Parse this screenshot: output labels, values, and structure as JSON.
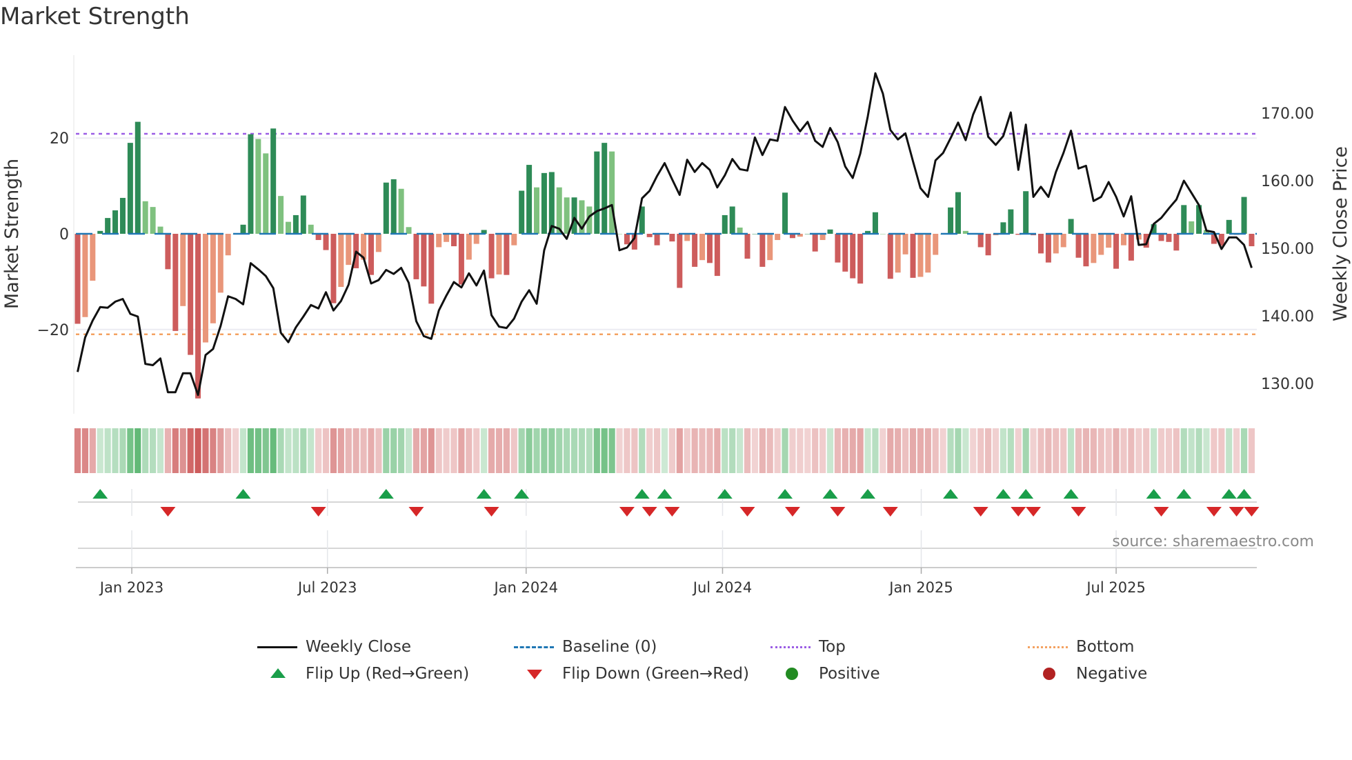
{
  "title": "Market Strength",
  "source": "source: sharemaestro.com",
  "legend": {
    "weekly_close": "Weekly Close",
    "baseline": "Baseline (0)",
    "top": "Top",
    "bottom": "Bottom",
    "flip_up": "Flip Up (Red→Green)",
    "flip_down": "Flip Down (Green→Red)",
    "positive": "Positive",
    "negative": "Negative"
  },
  "colors": {
    "close": "#111111",
    "baseline": "#1f77b4",
    "top": "#9b5de5",
    "bottom": "#f4a261",
    "pos_strong": "#2e8b57",
    "pos_weak": "#7fc17f",
    "neg_strong": "#cd5c5c",
    "neg_weak": "#e9967a",
    "flip_up": "#1a9e4a",
    "flip_down": "#d62728",
    "positive_dot": "#228b22",
    "negative_dot": "#b22222"
  },
  "chart_data": {
    "type": "bar",
    "title": "Market Strength",
    "ylabel": "Market Strength",
    "y2label": "Weekly Close Price",
    "ylim": [
      -37,
      37
    ],
    "y2lim": [
      126,
      178
    ],
    "yticks": [
      {
        "value": 20,
        "label": "20"
      },
      {
        "value": 0,
        "label": "0"
      },
      {
        "value": -20,
        "label": "−20"
      }
    ],
    "y2ticks": [
      {
        "value": 170,
        "label": "170.00"
      },
      {
        "value": 160,
        "label": "160.00"
      },
      {
        "value": 150,
        "label": "150.00"
      },
      {
        "value": 140,
        "label": "140.00"
      },
      {
        "value": 130,
        "label": "130.00"
      }
    ],
    "xticks": [
      {
        "week": 7.2,
        "label": "Jan 2023"
      },
      {
        "week": 33.2,
        "label": "Jul 2023"
      },
      {
        "week": 59.6,
        "label": "Jan 2024"
      },
      {
        "week": 85.7,
        "label": "Jul 2024"
      },
      {
        "week": 112.1,
        "label": "Jan 2025"
      },
      {
        "week": 138,
        "label": "Jul 2025"
      }
    ],
    "top_level": 20.9,
    "bottom_level": -21.0,
    "baseline": 0,
    "strength": [
      -18.8,
      -17.4,
      -9.8,
      0.6,
      3.3,
      4.9,
      7.5,
      19,
      23.4,
      6.8,
      5.6,
      1.5,
      -7.4,
      -20.3,
      -15.1,
      -25.3,
      -34.4,
      -22.7,
      -18.7,
      -12.3,
      -4.5,
      0,
      1.9,
      20.8,
      19.8,
      16.8,
      22,
      7.9,
      2.5,
      3.9,
      8,
      1.9,
      -1.3,
      -3.4,
      -14.5,
      -11.1,
      -6.5,
      -7.2,
      -5.4,
      -8.6,
      -3.8,
      10.7,
      11.4,
      9.4,
      1.4,
      -9.5,
      -11,
      -14.6,
      -2.8,
      -1.7,
      -2.6,
      -10.6,
      -5.4,
      -2.1,
      0.8,
      -9.3,
      -8.5,
      -8.6,
      -2.4,
      9,
      14.4,
      9.7,
      12.7,
      12.9,
      9.7,
      7.6,
      7.6,
      7,
      5.7,
      17.2,
      19,
      17.2,
      0,
      -2.2,
      -3.3,
      5.7,
      -0.7,
      -2.4,
      0.1,
      -1.6,
      -11.3,
      -1.5,
      -6.9,
      -5.5,
      -6.1,
      -8.8,
      3.9,
      5.7,
      1.3,
      -5.2,
      0,
      -6.9,
      -5.5,
      -1.3,
      8.6,
      -0.9,
      -0.6,
      0,
      -3.7,
      -1.3,
      0.9,
      -6,
      -7.9,
      -9.3,
      -10.4,
      0.6,
      4.5,
      0,
      -9.4,
      -8.1,
      -4.3,
      -9.2,
      -9,
      -8.1,
      -4.4,
      0,
      5.5,
      8.7,
      0.6,
      0,
      -2.8,
      -4.5,
      -0.3,
      2.4,
      5.1,
      -0.2,
      8.9,
      -0.3,
      -4.1,
      -6,
      -4.1,
      -2.8,
      3.1,
      -5,
      -6.8,
      -6.1,
      -4.4,
      -2.9,
      -7.3,
      -2.4,
      -5.6,
      -1.2,
      -2.9,
      2,
      -1.5,
      -1.7,
      -3.5,
      6,
      2.6,
      6,
      0.8,
      -2.1,
      -2.5,
      2.9,
      -0.2,
      7.7,
      -2.6
    ],
    "close": [
      131.7,
      136.8,
      139.3,
      141.3,
      141.2,
      142.1,
      142.5,
      140.3,
      139.9,
      132.9,
      132.7,
      133.7,
      128.7,
      128.7,
      131.5,
      131.5,
      128.3,
      134.2,
      135.1,
      138.5,
      142.9,
      142.5,
      141.7,
      147.8,
      146.9,
      145.9,
      144.1,
      137.5,
      136.1,
      138.3,
      139.9,
      141.6,
      141.1,
      143.5,
      140.8,
      142.2,
      144.6,
      149.5,
      148.6,
      144.8,
      145.3,
      146.8,
      146.2,
      147.1,
      144.9,
      139.2,
      137,
      136.6,
      140.8,
      143,
      145,
      144.2,
      146.3,
      144.5,
      146.7,
      140.1,
      138.4,
      138.2,
      139.6,
      142.1,
      143.8,
      141.8,
      149.7,
      153.3,
      152.9,
      151.4,
      154.5,
      152.9,
      154.7,
      155.5,
      155.9,
      156.4,
      149.7,
      150.1,
      151.5,
      157.4,
      158.5,
      160.7,
      162.6,
      160.2,
      157.9,
      163.1,
      161.3,
      162.6,
      161.6,
      159,
      160.8,
      163.2,
      161.7,
      161.5,
      166.4,
      163.8,
      166.1,
      165.9,
      170.9,
      168.9,
      167.3,
      168.7,
      165.9,
      165,
      167.8,
      165.7,
      162.1,
      160.4,
      164,
      169.5,
      175.9,
      172.9,
      167.5,
      166.1,
      167,
      162.9,
      158.9,
      157.6,
      163,
      164.1,
      166.3,
      168.6,
      166,
      169.8,
      172.4,
      166.5,
      165.3,
      166.6,
      170.1,
      161.6,
      168.3,
      157.6,
      159.1,
      157.6,
      161.3,
      164.1,
      167.4,
      161.8,
      162.2,
      157,
      157.6,
      159.8,
      157.6,
      154.7,
      157.7,
      150.5,
      150.6,
      153.6,
      154.5,
      155.9,
      157.2,
      160,
      158.2,
      156.4,
      152.6,
      152.4,
      149.9,
      151.6,
      151.6,
      150.5,
      147.1
    ],
    "flip_up_weeks": [
      3,
      22,
      41,
      54,
      59,
      75,
      78,
      86,
      94,
      100,
      105,
      116,
      123,
      126,
      132,
      143,
      147,
      153,
      155
    ],
    "flip_down_weeks": [
      12,
      32,
      45,
      55,
      73,
      76,
      79,
      89,
      95,
      101,
      108,
      120,
      125,
      127,
      133,
      144,
      151,
      154,
      156
    ]
  }
}
